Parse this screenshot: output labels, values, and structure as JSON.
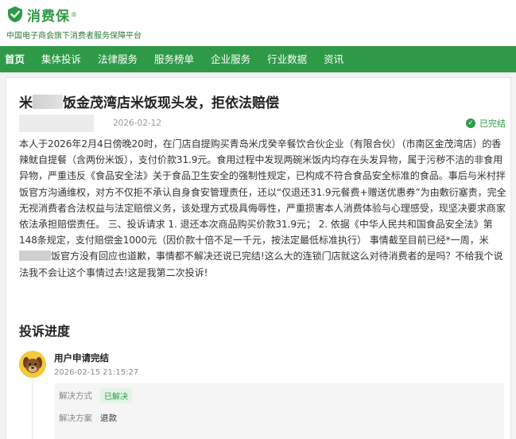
{
  "header": {
    "logo_text": "消费保",
    "logo_mark": "®",
    "slogan": "中国电子商会旗下消费者服务保障平台"
  },
  "nav": {
    "items": [
      {
        "label": "首页"
      },
      {
        "label": "集体投诉"
      },
      {
        "label": "法律服务"
      },
      {
        "label": "服务榜单"
      },
      {
        "label": "企业服务"
      },
      {
        "label": "行业数据"
      },
      {
        "label": "资讯"
      }
    ]
  },
  "complaint": {
    "title_pre": "米",
    "title_post": "饭金茂湾店米饭现头发，拒依法赔偿",
    "date": "2026-02-12",
    "status": "已完结",
    "body_part1": "本人于2026年2月4日傍晚20时，在门店自提购买青岛米戊癸辛餐饮合伙企业（有限合伙）（市南区金茂湾店）的香辣鱿自提餐（含两份米饭），支付价款31.9元。食用过程中发现两碗米饭内均存在头发异物，属于污秽不洁的非食用异物，严重违反《食品安全法》关于食品卫生安全的强制性规定，已构成不符合食品安全标准的食品。事后与米村拌饭官方沟通维权，对方不仅拒不承认自身食安管理责任，还以“仅退还31.9元餐费+赠送优惠券”为由敷衍塞责，完全无视消费者合法权益与法定赔偿义务，该处理方式极具侮辱性，严重损害本人消费体验与心理感受，现坚决要求商家依法承担赔偿责任。 三、投诉请求 1. 退还本次商品购买价款31.9元； 2. 依据《中华人民共和国食品安全法》第148条规定，支付赔偿金1000元（因价款十倍不足一千元，按法定最低标准执行） 事情截至目前已经*一周，米",
    "body_part2": "饭官方没有回应也道歉，事情都不解决还说已完结!这么大的连锁门店就这么对待消费者的是吗？不给我个说法我不会让这个事情过去!这是我第二次投诉!"
  },
  "progress": {
    "title": "投诉进度",
    "entry": {
      "name": "用户申请完结",
      "time": "2026-02-15 21:15:27",
      "method_label": "解决方式",
      "method_value": "已解决",
      "plan_label": "解决方案",
      "plan_value": "退款"
    }
  },
  "colors": {
    "brand_green": "#2e9a47",
    "avatar_yellow": "#f4c93c"
  },
  "icons": {
    "logo": "shield-logo-icon",
    "status": "check-circle-icon",
    "avatar": "dog-avatar-icon"
  }
}
